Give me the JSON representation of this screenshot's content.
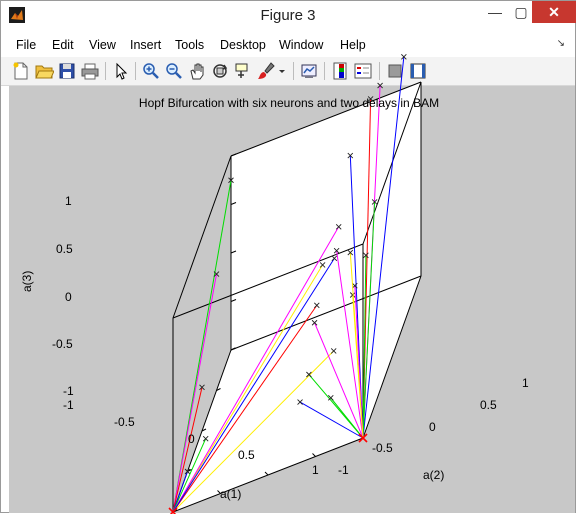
{
  "window": {
    "title": "Figure 3",
    "minimize_glyph": "—",
    "maximize_glyph": "▢",
    "close_glyph": "✕"
  },
  "menu": {
    "items": [
      "File",
      "Edit",
      "View",
      "Insert",
      "Tools",
      "Desktop",
      "Window",
      "Help"
    ],
    "overflow_glyph": "↘"
  },
  "toolbar": {
    "icons": [
      "new-figure-icon",
      "open-file-icon",
      "save-icon",
      "print-icon",
      "edit-plot-icon",
      "zoom-in-icon",
      "zoom-out-icon",
      "pan-icon",
      "rotate-3d-icon",
      "data-cursor-icon",
      "brush-icon",
      "link-plot-icon",
      "colorbar-icon",
      "legend-icon",
      "hide-plot-tools-icon",
      "show-plot-tools-icon"
    ]
  },
  "plot": {
    "title": "Hopf Bifurcation with six neurons and two delays in BAM",
    "xlabel": "a(1)",
    "ylabel": "a(2)",
    "zlabel": "a(3)",
    "x_ticks": [
      "-1",
      "-0.5",
      "0",
      "0.5",
      "1"
    ],
    "y_ticks": [
      "-1",
      "-0.5",
      "0",
      "0.5",
      "1"
    ],
    "z_ticks": [
      "1",
      "0.5",
      "0",
      "-0.5",
      "-1"
    ]
  },
  "chart_data": {
    "type": "line",
    "title": "Hopf Bifurcation with six neurons and two delays in BAM",
    "xlabel": "a(1)",
    "ylabel": "a(2)",
    "zlabel": "a(3)",
    "xlim": [
      -1,
      1
    ],
    "ylim": [
      -1,
      1
    ],
    "zlim": [
      -1,
      1
    ],
    "x_ticks": [
      -1,
      -0.5,
      0,
      0.5,
      1
    ],
    "y_ticks": [
      -1,
      -0.5,
      0,
      0.5,
      1
    ],
    "z_ticks": [
      -1,
      -0.5,
      0,
      0.5,
      1
    ],
    "grid": false,
    "box": true,
    "attractors": [
      [
        1,
        -1,
        -1
      ],
      [
        1,
        1,
        -1
      ]
    ],
    "series": [
      {
        "color": "#00dd00",
        "start": [
          -1,
          -1,
          0.75
        ],
        "end": [
          1,
          -1,
          -1
        ]
      },
      {
        "color": "#ff00ff",
        "start": [
          -0.5,
          -1,
          0.2
        ],
        "end": [
          1,
          -1,
          -1
        ]
      },
      {
        "color": "#ff0000",
        "start": [
          0,
          -1,
          -0.55
        ],
        "end": [
          1,
          -1,
          -1
        ]
      },
      {
        "color": "#0000ff",
        "start": [
          0.5,
          -1,
          -1
        ],
        "end": [
          1,
          -1,
          -1
        ]
      },
      {
        "color": "#00dd00",
        "start": [
          0.2,
          -0.9,
          -0.95
        ],
        "end": [
          1,
          -1,
          -1
        ]
      },
      {
        "color": "#ff00ff",
        "start": [
          -0.9,
          0.6,
          1.2
        ],
        "end": [
          1,
          1,
          -1
        ]
      },
      {
        "color": "#ff0000",
        "start": [
          -0.9,
          0.5,
          1.1
        ],
        "end": [
          1,
          1,
          -1
        ]
      },
      {
        "color": "#0000ff",
        "start": [
          -0.9,
          0.85,
          1.4
        ],
        "end": [
          1,
          1,
          -1
        ]
      },
      {
        "color": "#0000ff",
        "start": [
          -0.2,
          0.5,
          1.1
        ],
        "end": [
          1,
          1,
          -1
        ]
      },
      {
        "color": "#00dd00",
        "start": [
          0.6,
          1,
          1.1
        ],
        "end": [
          1,
          1,
          -1
        ]
      },
      {
        "color": "#00dd00",
        "start": [
          0.9,
          1,
          0.8
        ],
        "end": [
          1,
          1,
          -1
        ]
      },
      {
        "color": "#ffee00",
        "start": [
          0.7,
          0.6,
          -0.2
        ],
        "end": [
          1,
          -1,
          -1
        ]
      },
      {
        "color": "#ffee00",
        "start": [
          0.1,
          0.3,
          0.3
        ],
        "end": [
          1,
          -1,
          -1
        ]
      },
      {
        "color": "#ff00ff",
        "start": [
          0.2,
          0.5,
          0.7
        ],
        "end": [
          1,
          -1,
          -1
        ]
      },
      {
        "color": "#ff0000",
        "start": [
          0.3,
          0.3,
          0.05
        ],
        "end": [
          1,
          -1,
          -1
        ]
      },
      {
        "color": "#0000ff",
        "start": [
          0.35,
          0.5,
          0.5
        ],
        "end": [
          1,
          -1,
          -1
        ]
      },
      {
        "color": "#ff00ff",
        "start": [
          0.6,
          0.6,
          0.75
        ],
        "end": [
          1,
          1,
          -1
        ]
      },
      {
        "color": "#ffee00",
        "start": [
          0.7,
          0.8,
          0.3
        ],
        "end": [
          1,
          1,
          -1
        ]
      },
      {
        "color": "#ff00ff",
        "start": [
          0.3,
          0.7,
          0.1
        ],
        "end": [
          1,
          1,
          -1
        ]
      },
      {
        "color": "#00dd00",
        "start": [
          0.9,
          0.4,
          -0.2
        ],
        "end": [
          1,
          1,
          -1
        ]
      },
      {
        "color": "#ff00ff",
        "start": [
          0.05,
          0.2,
          -0.3
        ],
        "end": [
          1,
          1,
          -1
        ]
      },
      {
        "color": "#ffee00",
        "start": [
          -0.2,
          0.5,
          0.1
        ],
        "end": [
          1,
          1,
          -1
        ]
      },
      {
        "color": "#0000ff",
        "start": [
          0.55,
          0.2,
          -0.7
        ],
        "end": [
          1,
          1,
          -1
        ]
      },
      {
        "color": "#00dd00",
        "start": [
          0.8,
          0.6,
          -0.6
        ],
        "end": [
          1,
          1,
          -1
        ]
      }
    ]
  }
}
